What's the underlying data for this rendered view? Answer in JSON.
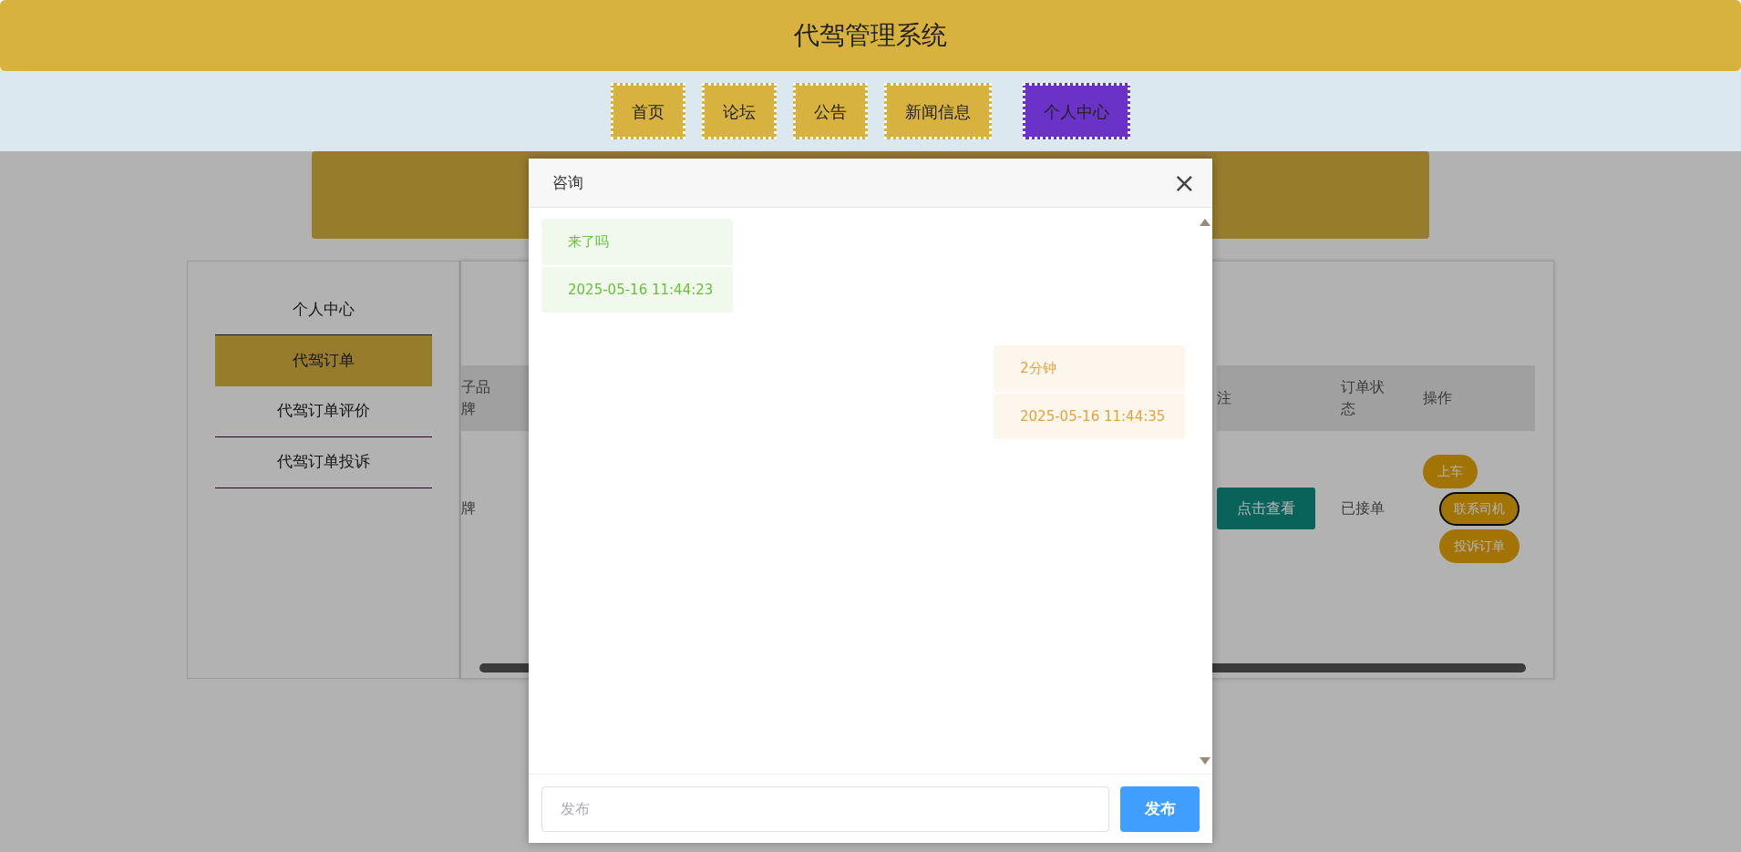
{
  "header": {
    "title": "代驾管理系统"
  },
  "nav": [
    {
      "label": "首页",
      "selected": false
    },
    {
      "label": "论坛",
      "selected": false
    },
    {
      "label": "公告",
      "selected": false
    },
    {
      "label": "新闻信息",
      "selected": false
    },
    {
      "label": "个人中心",
      "selected": true
    }
  ],
  "sidebar": {
    "title": "个人中心",
    "items": [
      {
        "label": "代驾订单",
        "selected": true
      },
      {
        "label": "代驾订单评价",
        "selected": false
      },
      {
        "label": "代驾订单投诉",
        "selected": false
      }
    ]
  },
  "table": {
    "left_columns": [
      "子品牌"
    ],
    "left_cells": [
      "牌"
    ],
    "right_columns": [
      "注",
      "订单状态",
      "操作"
    ],
    "row": {
      "view_button": "点击查看",
      "status": "已接单",
      "actions": [
        {
          "label": "上车",
          "focused": false
        },
        {
          "label": "联系司机",
          "focused": true
        },
        {
          "label": "投诉订单",
          "focused": false
        }
      ]
    }
  },
  "modal": {
    "title": "咨询",
    "close": "×",
    "messages": [
      {
        "kind": "left",
        "text": "来了吗",
        "time": "2025-05-16 11:44:23"
      },
      {
        "kind": "right",
        "text": "2分钟",
        "time": "2025-05-16 11:44:35"
      }
    ],
    "input": {
      "placeholder": "发布"
    },
    "send_button": "发布"
  }
}
